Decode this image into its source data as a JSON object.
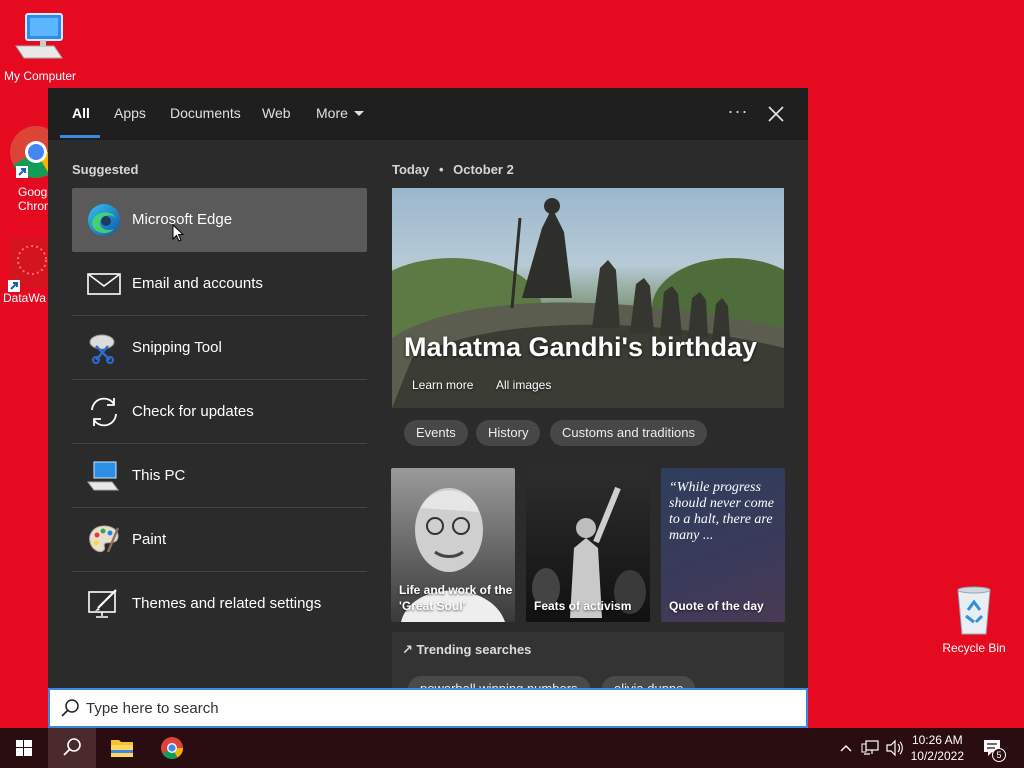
{
  "desktop": {
    "icons": [
      {
        "label": "My Computer"
      },
      {
        "label": "Goog Chron"
      },
      {
        "label": "DataWa"
      },
      {
        "label": "Recycle Bin"
      }
    ]
  },
  "tabs": {
    "all": "All",
    "apps": "Apps",
    "documents": "Documents",
    "web": "Web",
    "more": "More",
    "ellipsis": "···"
  },
  "suggested": {
    "title": "Suggested",
    "items": [
      {
        "label": "Microsoft Edge",
        "icon": "edge-icon"
      },
      {
        "label": "Email and accounts",
        "icon": "mail-icon"
      },
      {
        "label": "Snipping Tool",
        "icon": "scissors-icon"
      },
      {
        "label": "Check for updates",
        "icon": "refresh-icon"
      },
      {
        "label": "This PC",
        "icon": "computer-icon"
      },
      {
        "label": "Paint",
        "icon": "palette-icon"
      },
      {
        "label": "Themes and related settings",
        "icon": "brush-icon"
      }
    ]
  },
  "today": {
    "label": "Today",
    "separator": "•",
    "date": "October 2",
    "hero_title": "Mahatma Gandhi's birthday",
    "learn_more": "Learn more",
    "all_images": "All images",
    "chips": [
      "Events",
      "History",
      "Customs and traditions"
    ],
    "cards": [
      {
        "caption": "Life and work of the 'Great Soul'"
      },
      {
        "caption": "Feats of activism"
      },
      {
        "caption": "Quote of the day",
        "quote": "“While progress should never come to a halt, there are many ..."
      }
    ],
    "trending_title": "Trending searches",
    "trending": [
      "powerball winning numbers",
      "olivia dunne"
    ]
  },
  "search": {
    "placeholder": "Type here to search"
  },
  "taskbar": {
    "time": "10:26 AM",
    "date": "10/2/2022",
    "notifications": "5"
  },
  "colors": {
    "desktop": "#e50a1f",
    "accent": "#3a8be0",
    "panel": "#2b2b2b"
  }
}
